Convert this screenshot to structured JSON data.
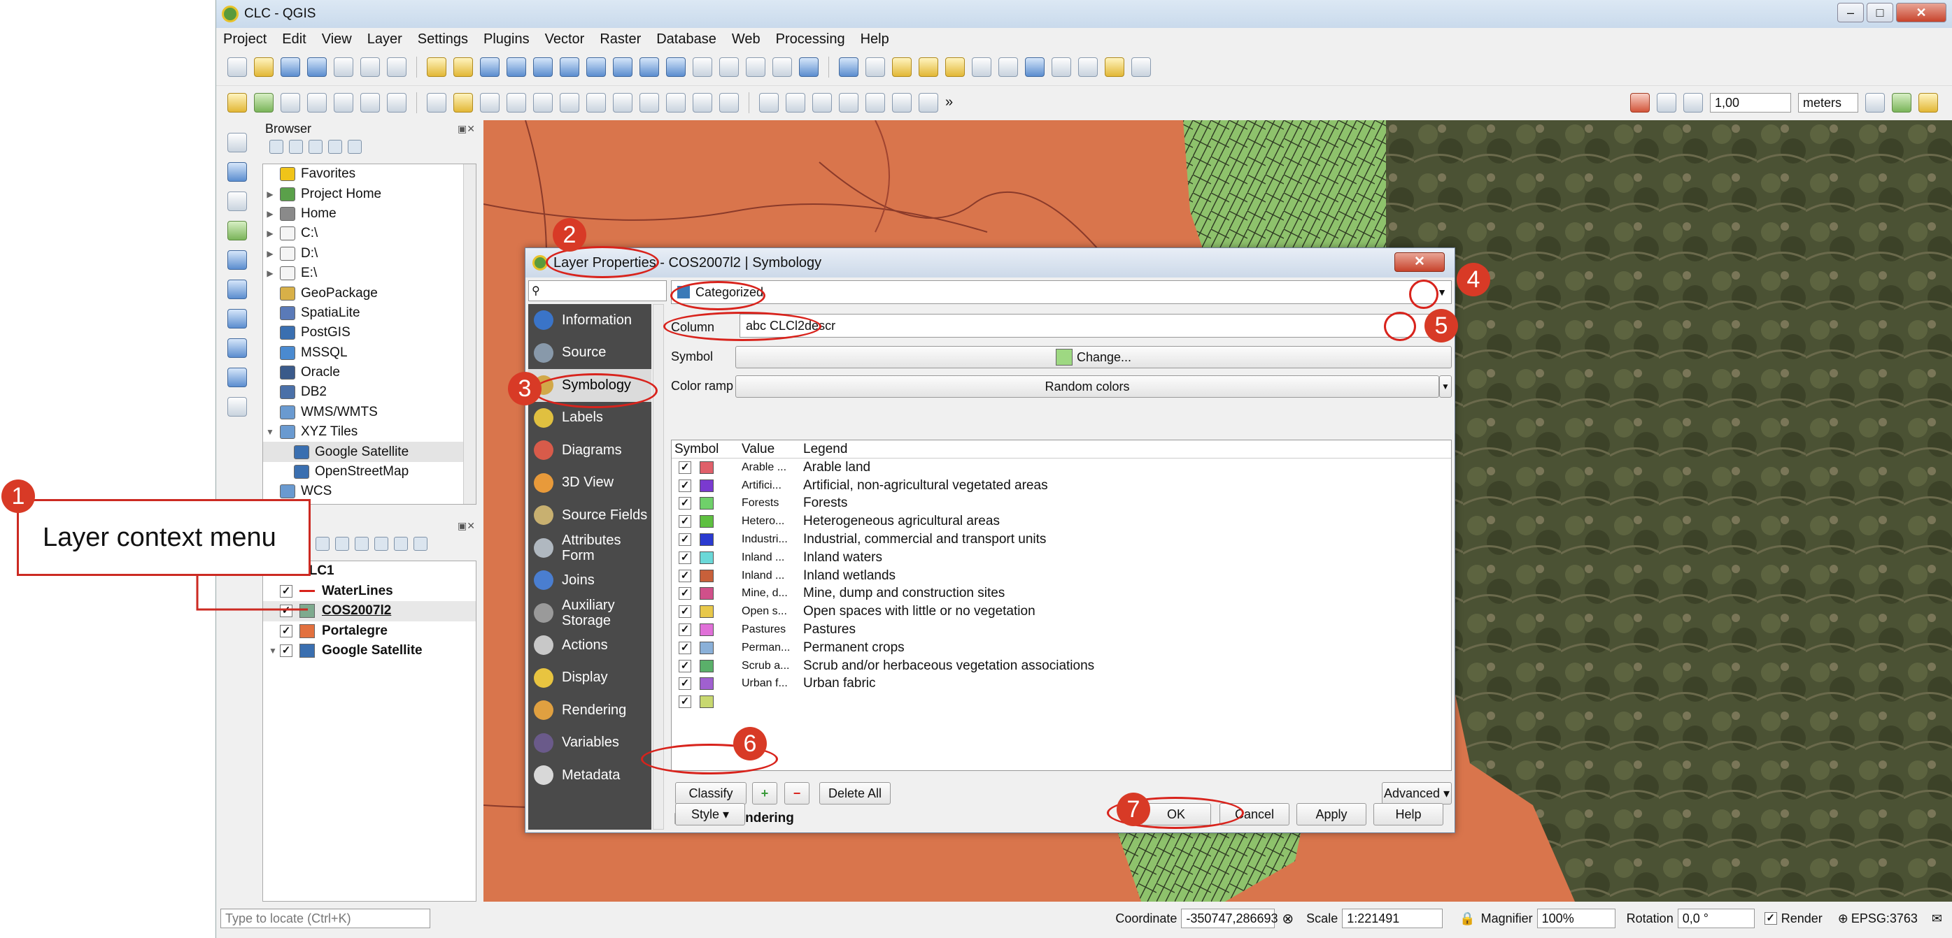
{
  "window": {
    "title": "CLC - QGIS"
  },
  "menu": [
    "Project",
    "Edit",
    "View",
    "Layer",
    "Settings",
    "Plugins",
    "Vector",
    "Raster",
    "Database",
    "Web",
    "Processing",
    "Help"
  ],
  "snapping": {
    "tolerance": "1,00",
    "unit": "meters"
  },
  "browser": {
    "title": "Browser",
    "items": [
      {
        "label": "Favorites",
        "icon": "star-icon"
      },
      {
        "label": "Project Home",
        "icon": "project-home-icon"
      },
      {
        "label": "Home",
        "icon": "home-icon"
      },
      {
        "label": "C:\\",
        "icon": "folder-icon"
      },
      {
        "label": "D:\\",
        "icon": "folder-icon"
      },
      {
        "label": "E:\\",
        "icon": "folder-icon"
      },
      {
        "label": "GeoPackage",
        "icon": "geopackage-icon"
      },
      {
        "label": "SpatiaLite",
        "icon": "spatialite-icon"
      },
      {
        "label": "PostGIS",
        "icon": "postgis-icon"
      },
      {
        "label": "MSSQL",
        "icon": "mssql-icon"
      },
      {
        "label": "Oracle",
        "icon": "oracle-icon"
      },
      {
        "label": "DB2",
        "icon": "db2-icon"
      },
      {
        "label": "WMS/WMTS",
        "icon": "wms-icon"
      },
      {
        "label": "XYZ Tiles",
        "icon": "xyz-icon"
      },
      {
        "label": "Google Satellite",
        "icon": "tile-icon"
      },
      {
        "label": "OpenStreetMap",
        "icon": "tile-icon"
      },
      {
        "label": "WCS",
        "icon": "wcs-icon"
      }
    ]
  },
  "layers": [
    {
      "label": "CLC1",
      "checked": false,
      "color": ""
    },
    {
      "label": "WaterLines",
      "checked": true,
      "color": "#d8231c"
    },
    {
      "label": "COS2007l2",
      "checked": true,
      "color": "#7eaa8e"
    },
    {
      "label": "Portalegre",
      "checked": true,
      "color": "#e2703e"
    },
    {
      "label": "Google Satellite",
      "checked": true,
      "color": "#3a6fb0"
    }
  ],
  "callout": {
    "text": "Layer context menu"
  },
  "dialog": {
    "title": "Layer Properties - COS2007l2 | Symbology",
    "search_placeholder": "",
    "renderer": "Categorized",
    "column_label": "Column",
    "column_value": "abc CLCl2descr",
    "symbol_label": "Symbol",
    "symbol_button": "Change...",
    "color_ramp_label": "Color ramp",
    "color_ramp_value": "Random colors",
    "headers": {
      "symbol": "Symbol",
      "value": "Value",
      "legend": "Legend"
    },
    "nav": [
      {
        "label": "Information",
        "color": "#3a74c8"
      },
      {
        "label": "Source",
        "color": "#8899aa"
      },
      {
        "label": "Symbology",
        "color": "#d2a848"
      },
      {
        "label": "Labels",
        "color": "#e0c040"
      },
      {
        "label": "Diagrams",
        "color": "#d85b4a"
      },
      {
        "label": "3D View",
        "color": "#e89a3a"
      },
      {
        "label": "Source Fields",
        "color": "#c8b070"
      },
      {
        "label": "Attributes Form",
        "color": "#b0b8c0"
      },
      {
        "label": "Joins",
        "color": "#4a7ed0"
      },
      {
        "label": "Auxiliary Storage",
        "color": "#9a9a9a"
      },
      {
        "label": "Actions",
        "color": "#c8c8c8"
      },
      {
        "label": "Display",
        "color": "#e8c440"
      },
      {
        "label": "Rendering",
        "color": "#e0a040"
      },
      {
        "label": "Variables",
        "color": "#6a5a8a"
      },
      {
        "label": "Metadata",
        "color": "#d8d8d8"
      }
    ],
    "categories": [
      {
        "value": "Arable ...",
        "legend": "Arable land",
        "color": "#e0606a"
      },
      {
        "value": "Artifici...",
        "legend": "Artificial, non-agricultural vegetated areas",
        "color": "#7a3ad0"
      },
      {
        "value": "Forests",
        "legend": "Forests",
        "color": "#6fd06a"
      },
      {
        "value": "Hetero...",
        "legend": "Heterogeneous agricultural areas",
        "color": "#5ec040"
      },
      {
        "value": "Industri...",
        "legend": "Industrial, commercial and transport units",
        "color": "#2a3ad0"
      },
      {
        "value": "Inland ...",
        "legend": "Inland waters",
        "color": "#6ad8d8"
      },
      {
        "value": "Inland ...",
        "legend": "Inland wetlands",
        "color": "#c8603a"
      },
      {
        "value": "Mine, d...",
        "legend": "Mine, dump and construction sites",
        "color": "#d0508a"
      },
      {
        "value": "Open s...",
        "legend": "Open spaces with little or no vegetation",
        "color": "#e8c84a"
      },
      {
        "value": "Pastures",
        "legend": "Pastures",
        "color": "#e070d8"
      },
      {
        "value": "Perman...",
        "legend": "Permanent crops",
        "color": "#8ab0d8"
      },
      {
        "value": "Scrub a...",
        "legend": "Scrub and/or herbaceous vegetation associations",
        "color": "#5ab06a"
      },
      {
        "value": "Urban f...",
        "legend": "Urban fabric",
        "color": "#a060d0"
      },
      {
        "value": "",
        "legend": "",
        "color": "#c8d870"
      }
    ],
    "buttons": {
      "classify": "Classify",
      "delete_all": "Delete All",
      "advanced": "Advanced",
      "layer_rendering": "Layer Rendering",
      "style": "Style",
      "ok": "OK",
      "cancel": "Cancel",
      "apply": "Apply",
      "help": "Help"
    }
  },
  "annotations": [
    "1",
    "2",
    "3",
    "4",
    "5",
    "6",
    "7"
  ],
  "status": {
    "locate_placeholder": "Type to locate (Ctrl+K)",
    "coordinate_label": "Coordinate",
    "coordinate": "-350747,286693",
    "scale_label": "Scale",
    "scale": "1:221491",
    "magnifier_label": "Magnifier",
    "magnifier": "100%",
    "rotation_label": "Rotation",
    "rotation": "0,0 °",
    "render_label": "Render",
    "crs": "EPSG:3763"
  }
}
